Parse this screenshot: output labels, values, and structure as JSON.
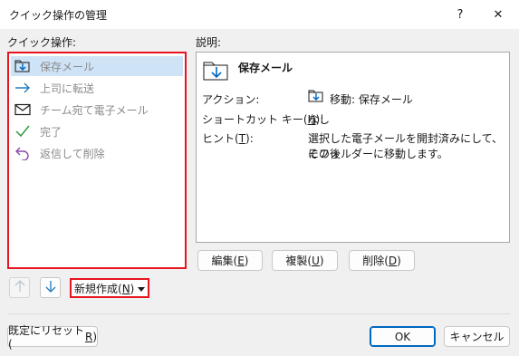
{
  "window": {
    "title": "クイック操作の管理",
    "help_glyph": "?",
    "close_glyph": "✕"
  },
  "quick_actions": {
    "label": "クイック操作:",
    "items": [
      {
        "label": "保存メール",
        "icon": "folder-save-icon",
        "selected": true
      },
      {
        "label": "上司に転送",
        "icon": "forward-arrow-icon",
        "selected": false
      },
      {
        "label": "チーム宛て電子メール",
        "icon": "envelope-icon",
        "selected": false
      },
      {
        "label": "完了",
        "icon": "checkmark-icon",
        "selected": false
      },
      {
        "label": "返信して削除",
        "icon": "reply-delete-icon",
        "selected": false
      }
    ]
  },
  "description": {
    "label": "説明:",
    "heading": "保存メール",
    "action_label": "アクション:",
    "action_value": "移動: 保存メール",
    "shortcut_label_pre": "ショートカット キー(",
    "shortcut_key": "H",
    "shortcut_label_post": "):",
    "shortcut_value": "なし",
    "hint_label_pre": "ヒント(",
    "hint_key": "T",
    "hint_label_post": "):",
    "hint_line1": "選択した電子メールを開封済みにして、その後",
    "hint_line2": "にフォルダーに移動します。"
  },
  "buttons": {
    "edit_pre": "編集(",
    "edit_key": "E",
    "edit_post": ")",
    "copy_pre": "複製(",
    "copy_key": "U",
    "copy_post": ")",
    "delete_pre": "削除(",
    "delete_key": "D",
    "delete_post": ")",
    "new_pre": "新規作成(",
    "new_key": "N",
    "new_post": ")",
    "reset_pre": "既定にリセット(",
    "reset_key": "R",
    "reset_post": ")",
    "ok": "OK",
    "cancel": "キャンセル"
  },
  "colors": {
    "highlight_border": "#e8141e",
    "selection": "#cfe3f6",
    "accent": "#0067c0"
  }
}
